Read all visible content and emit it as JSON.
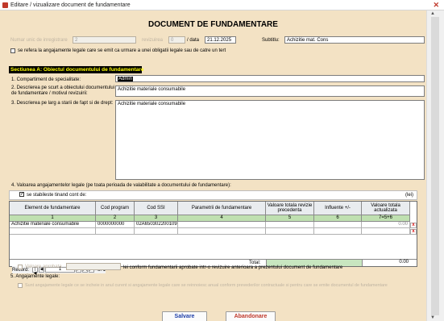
{
  "window": {
    "title": "Editare / vizualizare document de fundamentare"
  },
  "doc_title": "DOCUMENT DE FUNDAMENTARE",
  "header": {
    "nr_label": "Numar unic de inregistrare",
    "nr_value": "2",
    "revision_label": "revizuirea",
    "revision_value": "0",
    "date_label": "/ data",
    "date_value": "21.12.2025",
    "subtitle_label": "Subtitlu:",
    "subtitle_value": "Achizitie mat. Cons",
    "legal_check_label": "se refera la angajamente legale care se emit ca urmare a unei obligatii legale sau de catre un tert"
  },
  "section_a": {
    "title": "Sectiunea A: Obiectul documentului de fundamentare",
    "q1_label": "1. Compartiment de specialitate:",
    "q1_value": "Admin",
    "q2_label_1": "2. Descrierea pe scurt a obiectului documentului",
    "q2_label_2": "de fundamentare / motivul revizuirii:",
    "q2_value": "Achizitie materiale consumabile",
    "q3_label": "3. Descrierea pe larg a starii de fapt si de drept:",
    "q3_value": "Achizitie materiale consumabile",
    "q4_label": "4. Valoarea angajamentelor legale (pe toata perioada de valabilitate a documentului de fundamentare):",
    "q4_check_label": "se stabileste tinand cont de:",
    "unit_label": "(lei)"
  },
  "grid": {
    "headers": [
      "Element de fundamentare",
      "Cod program",
      "Cod SSI",
      "Parametrii de fundamentare",
      "Valoare totala revizie precedenta",
      "Influente +/-",
      "Valoare totala actualizata"
    ],
    "col_numbers": [
      "1",
      "2",
      "3",
      "4",
      "5",
      "6",
      "7=5+6"
    ],
    "rows": [
      {
        "element": "Achizitie materiale consumabile",
        "cod_program": "0000000000",
        "cod_ssi": "02A650302200109",
        "parametri": "",
        "val_prec": "",
        "influente": "",
        "val_act": "0.00"
      }
    ],
    "total_label": "Total:",
    "total_value": "0.00",
    "delete_glyph": "x"
  },
  "navigator": {
    "label": "Record:",
    "position": "1",
    "of_label": "of 1"
  },
  "after_grid": {
    "check_label": "Valoare aprobata",
    "text": "lei conform fundamentarii aprobate intr-o revizuire anterioara a prezentului document de fundamentare"
  },
  "section_5": {
    "title": "5. Angajamente legale:",
    "check_label": "Sunt angajamente legale ce se incheie in anul curent si angajamente legale care se reinnoiesc anual conform prevederilor contractuale si pentru care se emite documentul de fundamentare"
  },
  "buttons": {
    "save": "Salvare",
    "cancel": "Abandonare"
  },
  "colors": {
    "form_bg": "#f3e2c4",
    "section_head_bg": "#000000",
    "section_head_fg": "#ffff00",
    "save_fg": "#1d3ea8",
    "cancel_fg": "#c0392b"
  }
}
